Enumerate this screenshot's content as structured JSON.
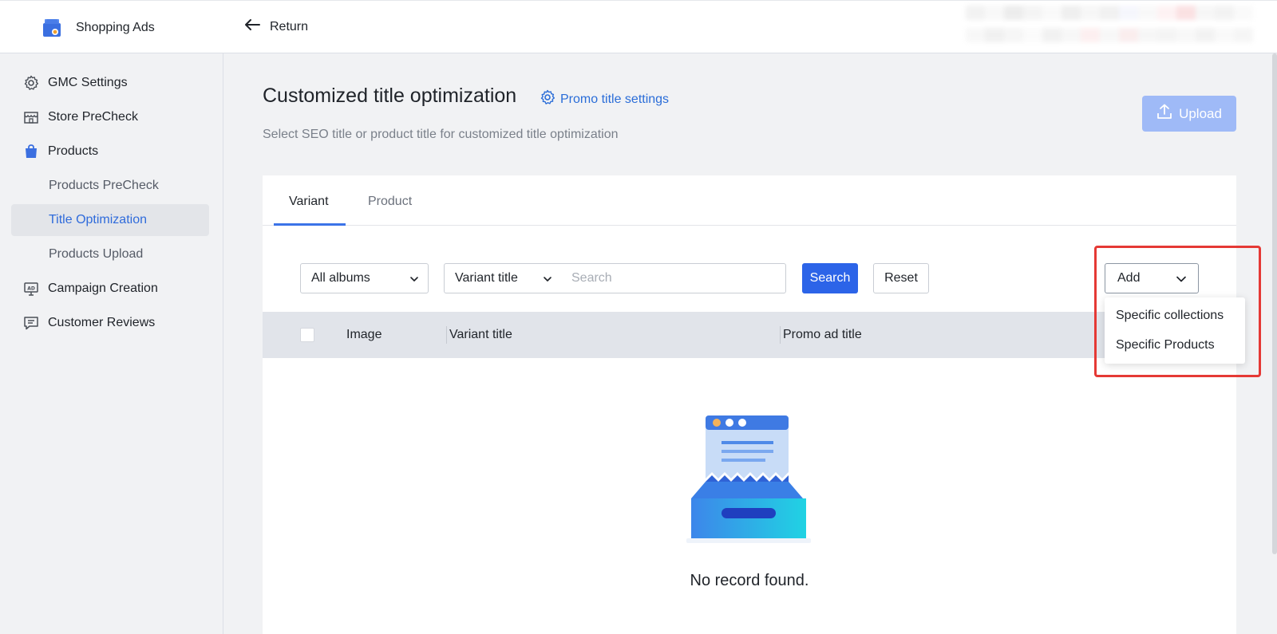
{
  "header": {
    "app_title": "Shopping Ads",
    "return_label": "Return"
  },
  "sidebar": {
    "items": [
      {
        "label": "GMC Settings",
        "icon": "gear-icon"
      },
      {
        "label": "Store PreCheck",
        "icon": "store-icon"
      },
      {
        "label": "Products",
        "icon": "shopping-bag-icon"
      },
      {
        "label": "Products PreCheck"
      },
      {
        "label": "Title Optimization",
        "active": true
      },
      {
        "label": "Products Upload"
      },
      {
        "label": "Campaign Creation",
        "icon": "ad-screen-icon"
      },
      {
        "label": "Customer Reviews",
        "icon": "comment-icon"
      }
    ]
  },
  "main": {
    "title": "Customized title optimization",
    "promo_link": "Promo title settings",
    "subtitle": "Select SEO title or product title for customized title optimization",
    "upload_label": "Upload",
    "tabs": [
      {
        "label": "Variant",
        "active": true
      },
      {
        "label": "Product"
      }
    ],
    "filters": {
      "albums_value": "All albums",
      "field_value": "Variant title",
      "search_placeholder": "Search",
      "search_button": "Search",
      "reset_button": "Reset"
    },
    "add": {
      "label": "Add",
      "options": [
        "Specific collections",
        "Specific Products"
      ]
    },
    "table": {
      "columns": [
        "Image",
        "Variant title",
        "Promo ad title"
      ]
    },
    "empty_text": "No record found."
  },
  "colors": {
    "primary": "#2c64e8",
    "link": "#2a6dd8",
    "upload_disabled": "#9fbaf7",
    "highlight": "#e53935"
  }
}
